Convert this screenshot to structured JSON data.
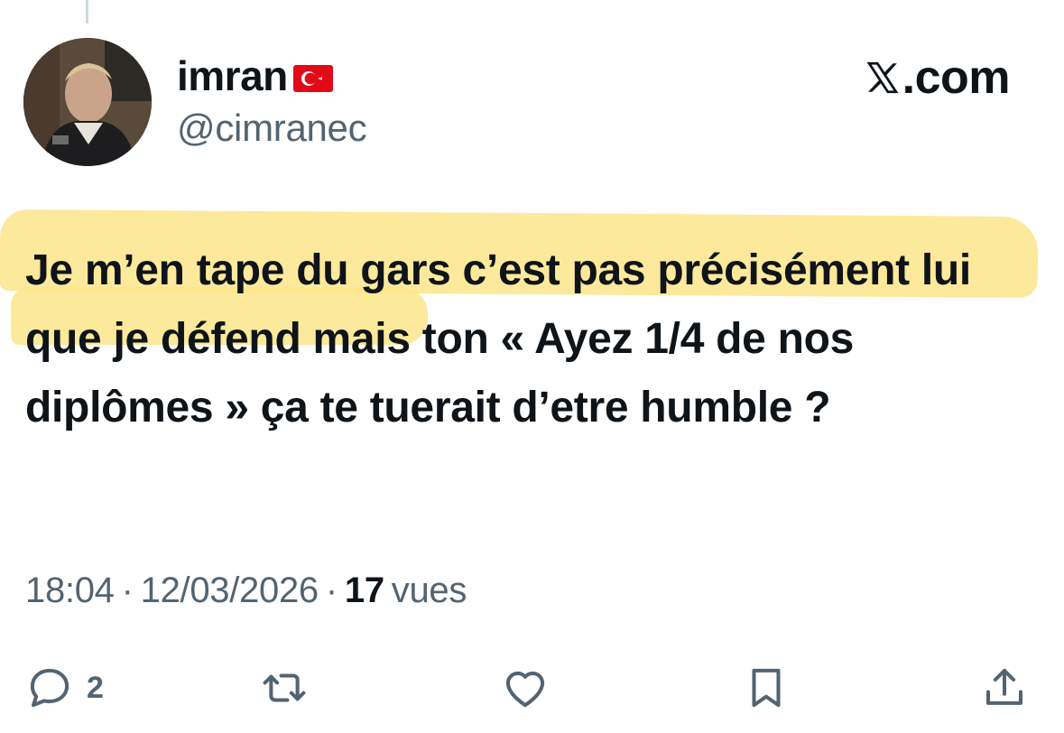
{
  "tweet": {
    "display_name": "imran",
    "flag_icon": "turkey-flag-icon",
    "handle": "@cimranec",
    "source": "com",
    "text": "Je m’en tape du gars c’est pas précisément lui que je défend mais ton « Ayez 1/4 de nos diplômes » ça te tuerait d’etre humble ?",
    "time": "18:04",
    "separator": "·",
    "date": "12/03/2026",
    "views_count": "17",
    "views_label": "vues"
  },
  "actions": {
    "reply_icon": "reply-icon",
    "reply_count": "2",
    "repost_icon": "repost-icon",
    "like_icon": "heart-icon",
    "bookmark_icon": "bookmark-icon",
    "share_icon": "share-icon"
  },
  "colors": {
    "text": "#0f1419",
    "secondary": "#536471",
    "highlight": "#fde58a"
  }
}
